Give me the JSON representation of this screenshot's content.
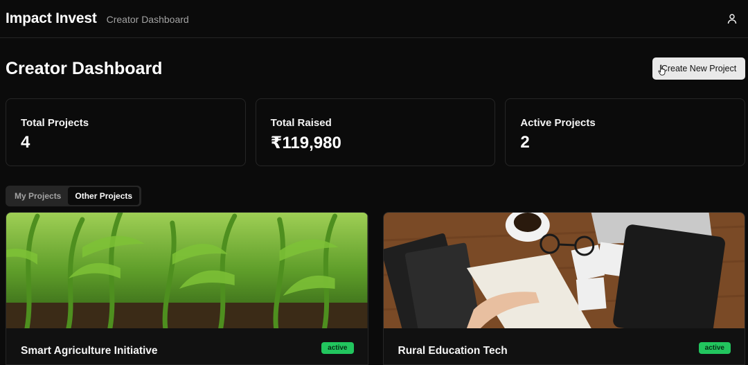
{
  "app": {
    "brand": "Impact Invest",
    "subtitle": "Creator Dashboard"
  },
  "header": {
    "title": "Creator Dashboard",
    "create_label": "Create New Project"
  },
  "stats": [
    {
      "label": "Total Projects",
      "value": "4"
    },
    {
      "label": "Total Raised",
      "value": "₹119,980"
    },
    {
      "label": "Active Projects",
      "value": "2"
    }
  ],
  "tabs": [
    {
      "label": "My Projects",
      "active": false
    },
    {
      "label": "Other Projects",
      "active": true
    }
  ],
  "projects": [
    {
      "title": "Smart Agriculture Initiative",
      "status": "active",
      "image": "corn-field-photo"
    },
    {
      "title": "Rural Education Tech",
      "status": "active",
      "image": "desk-with-book-photo"
    }
  ],
  "colors": {
    "background": "#0b0b0b",
    "badge": "#22c55e",
    "button": "#e9e9e9"
  },
  "icons": {
    "user": "user-icon",
    "cursor": "hand-pointer-icon"
  }
}
